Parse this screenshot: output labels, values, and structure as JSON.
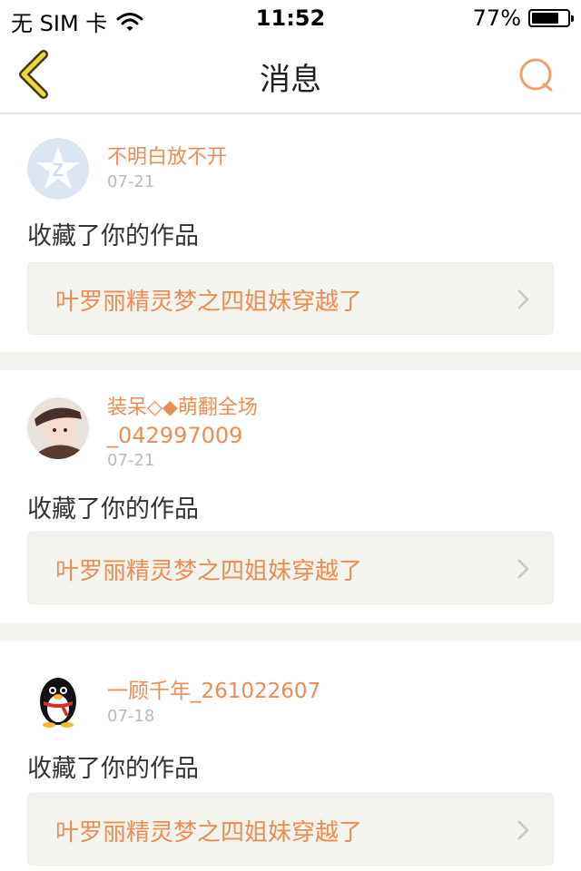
{
  "status_bar": {
    "carrier": "无 SIM 卡",
    "time": "11:52",
    "battery_text": "77%",
    "battery_level": 0.77
  },
  "nav": {
    "title": "消息"
  },
  "colors": {
    "accent": "#ed8b55",
    "date": "#b9b9b9",
    "separator": "#f5f4f1",
    "back_icon": "#f1d83c"
  },
  "messages": [
    {
      "username": "不明白放不开",
      "date": "07-21",
      "action": "收藏了你的作品",
      "work_title": "叶罗丽精灵梦之四姐妹穿越了",
      "avatar": "qzone-star-icon"
    },
    {
      "username_line1": "装呆◇◆萌翻全场",
      "username_line2": "_042997009",
      "date": "07-21",
      "action": "收藏了你的作品",
      "work_title": "叶罗丽精灵梦之四姐妹穿越了",
      "avatar": "user-photo"
    },
    {
      "username": "一顾千年_261022607",
      "date": "07-18",
      "action": "收藏了你的作品",
      "work_title": "叶罗丽精灵梦之四姐妹穿越了",
      "avatar": "qq-penguin-icon"
    }
  ]
}
